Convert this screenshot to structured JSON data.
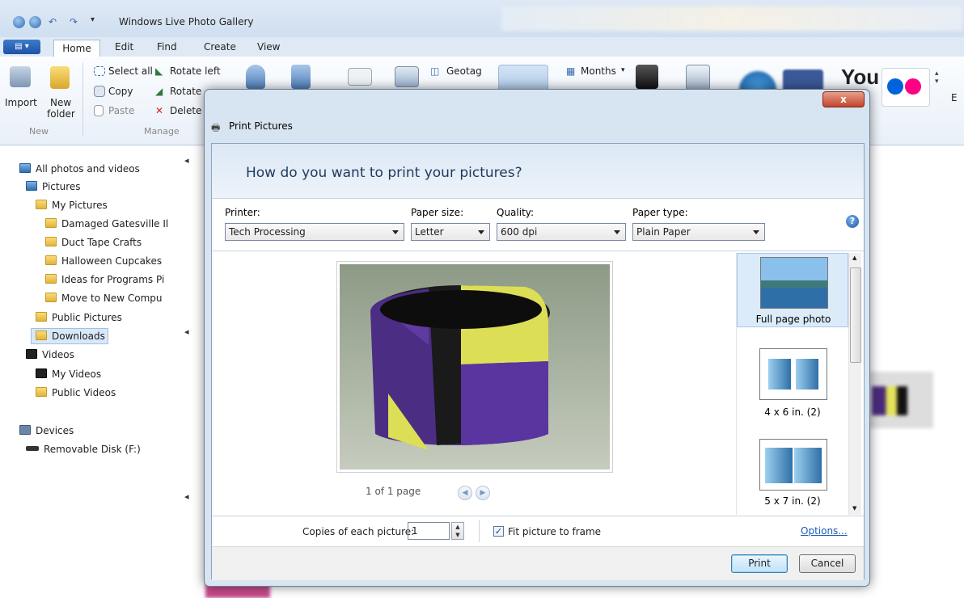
{
  "app": {
    "title": "Windows Live Photo Gallery"
  },
  "ribbon": {
    "tabs": [
      "Home",
      "Edit",
      "Find",
      "Create",
      "View"
    ],
    "new_group": {
      "import": "Import",
      "new_folder_1": "New",
      "new_folder_2": "folder",
      "label": "New"
    },
    "manage_group": {
      "select_all": "Select all",
      "copy": "Copy",
      "paste": "Paste",
      "rotate_left": "Rotate left",
      "rotate_right": "Rotate",
      "delete": "Delete",
      "label": "Manage"
    },
    "geotag": "Geotag",
    "months": "Months",
    "email_partial": "E"
  },
  "tree": {
    "all": "All photos and videos",
    "pictures": "Pictures",
    "my_pictures": "My Pictures",
    "folders": [
      "Damaged Gatesville Il",
      "Duct Tape Crafts",
      "Halloween Cupcakes",
      "Ideas for Programs Pi",
      "Move to New Compu"
    ],
    "public_pictures": "Public Pictures",
    "downloads": "Downloads",
    "videos": "Videos",
    "my_videos": "My Videos",
    "public_videos": "Public Videos",
    "devices": "Devices",
    "removable_disk": "Removable Disk (F:)"
  },
  "dialog": {
    "title": "Print Pictures",
    "close": "x",
    "question": "How do you want to print your pictures?",
    "printer": {
      "label": "Printer:",
      "value": "Tech Processing"
    },
    "paper_size": {
      "label": "Paper size:",
      "value": "Letter"
    },
    "quality": {
      "label": "Quality:",
      "value": "600 dpi"
    },
    "paper_type": {
      "label": "Paper type:",
      "value": "Plain Paper"
    },
    "page_info": "1 of 1 page",
    "layouts": [
      {
        "label": "Full page photo"
      },
      {
        "label": "4 x 6 in. (2)"
      },
      {
        "label": "5 x 7 in. (2)"
      }
    ],
    "copies_label": "Copies of each picture:",
    "copies_value": "1",
    "fit_label": "Fit picture to frame",
    "fit_checked": true,
    "options": "Options...",
    "print": "Print",
    "cancel": "Cancel"
  }
}
